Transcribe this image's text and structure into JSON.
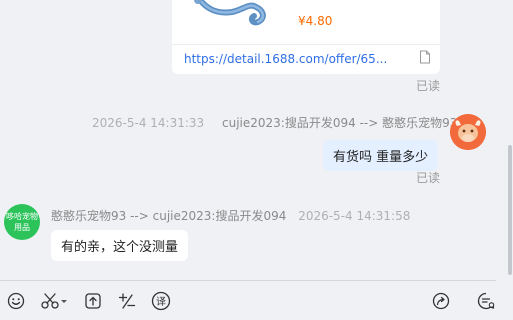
{
  "product": {
    "price": "¥4.80",
    "link": "https://detail.1688.com/offer/65...",
    "read_status": "已读"
  },
  "outgoing": {
    "time": "2026-5-4 14:31:33",
    "sender": "cujie2023:搜品开发094 --> 憨憨乐宠物93",
    "text": "有货吗 重量多少",
    "read_status": "已读"
  },
  "incoming": {
    "avatar_text": "哆哈宠物用品",
    "sender": "憨憨乐宠物93 --> cujie2023:搜品开发094",
    "time": "2026-5-4 14:31:58",
    "text": "有的亲，这个没测量"
  },
  "toolbar": {
    "icons": [
      "emoji-icon",
      "scissors-icon",
      "upload-icon",
      "quick-phrase-icon",
      "translate-icon",
      "share-icon",
      "chat-history-icon"
    ],
    "translate_glyph": "译"
  },
  "colors": {
    "price": "#ff6a00",
    "link": "#2f6fe4",
    "outgoing_bubble": "#e4efff",
    "shop_avatar": "#2bc35a",
    "seller_avatar": "#f26a3b"
  }
}
